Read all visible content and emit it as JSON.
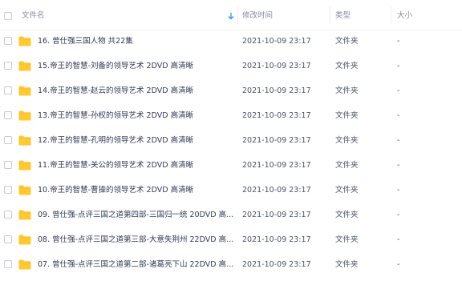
{
  "header": {
    "name": "文件名",
    "modified": "修改时间",
    "type": "类型",
    "size": "大小"
  },
  "colors": {
    "folder": "#ffc933",
    "sort_accent": "#2e8ef0"
  },
  "files": [
    {
      "name": "16. 曾仕强三国人物 共22集",
      "modified": "2021-10-09 23:17",
      "type": "文件夹",
      "size": "-"
    },
    {
      "name": "15.帝王的智慧-刘备的领导艺术 2DVD 高清晰",
      "modified": "2021-10-09 23:17",
      "type": "文件夹",
      "size": "-"
    },
    {
      "name": "14.帝王的智慧-赵云的领导艺术 2DVD 高清晰",
      "modified": "2021-10-09 23:17",
      "type": "文件夹",
      "size": "-"
    },
    {
      "name": "13.帝王的智慧-孙权的领导艺术 2DVD 高清晰",
      "modified": "2021-10-09 23:17",
      "type": "文件夹",
      "size": "-"
    },
    {
      "name": "12.帝王的智慧-孔明的领导艺术 2DVD 高清晰",
      "modified": "2021-10-09 23:17",
      "type": "文件夹",
      "size": "-"
    },
    {
      "name": "11.帝王的智慧-关公的领导艺术 2DVD 高清晰",
      "modified": "2021-10-09 23:17",
      "type": "文件夹",
      "size": "-"
    },
    {
      "name": "10.帝王的智慧-曹操的领导艺术 2DVD 高清晰",
      "modified": "2021-10-09 23:17",
      "type": "文件夹",
      "size": "-"
    },
    {
      "name": "09. 曾仕强-点评三国之道第四部-三国归一统 20DVD 高...",
      "modified": "2021-10-09 23:17",
      "type": "文件夹",
      "size": "-"
    },
    {
      "name": "08. 曾仕强-点评三国之道第三部-大意失荆州 22DVD 高...",
      "modified": "2021-10-09 23:17",
      "type": "文件夹",
      "size": "-"
    },
    {
      "name": "07. 曾仕强-点评三国之道第二部-诸葛亮下山 22DVD 高...",
      "modified": "2021-10-09 23:17",
      "type": "文件夹",
      "size": "-"
    }
  ]
}
